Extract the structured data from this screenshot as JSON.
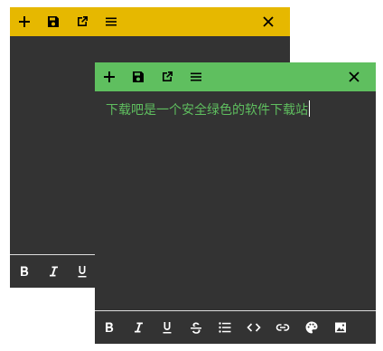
{
  "colors": {
    "back_note_header": "#e6b800",
    "front_note_header": "#5fbf5f",
    "note_background": "#333333",
    "front_note_text": "#5fbf5f",
    "icon": "#000000",
    "toolbar_icon": "#ffffff"
  },
  "back_note": {
    "titlebar_icons": [
      "add-icon",
      "save-icon",
      "open-external-icon",
      "menu-icon",
      "close-icon"
    ],
    "formatbar_icons": [
      "bold-icon",
      "italic-icon",
      "underline-icon"
    ]
  },
  "front_note": {
    "content": "下载吧是一个安全绿色的软件下载站",
    "titlebar_icons": [
      "add-icon",
      "save-icon",
      "open-external-icon",
      "menu-icon",
      "close-icon"
    ],
    "formatbar_icons": [
      "bold-icon",
      "italic-icon",
      "underline-icon",
      "strikethrough-icon",
      "bulleted-list-icon",
      "code-icon",
      "link-icon",
      "palette-icon",
      "image-icon"
    ]
  }
}
